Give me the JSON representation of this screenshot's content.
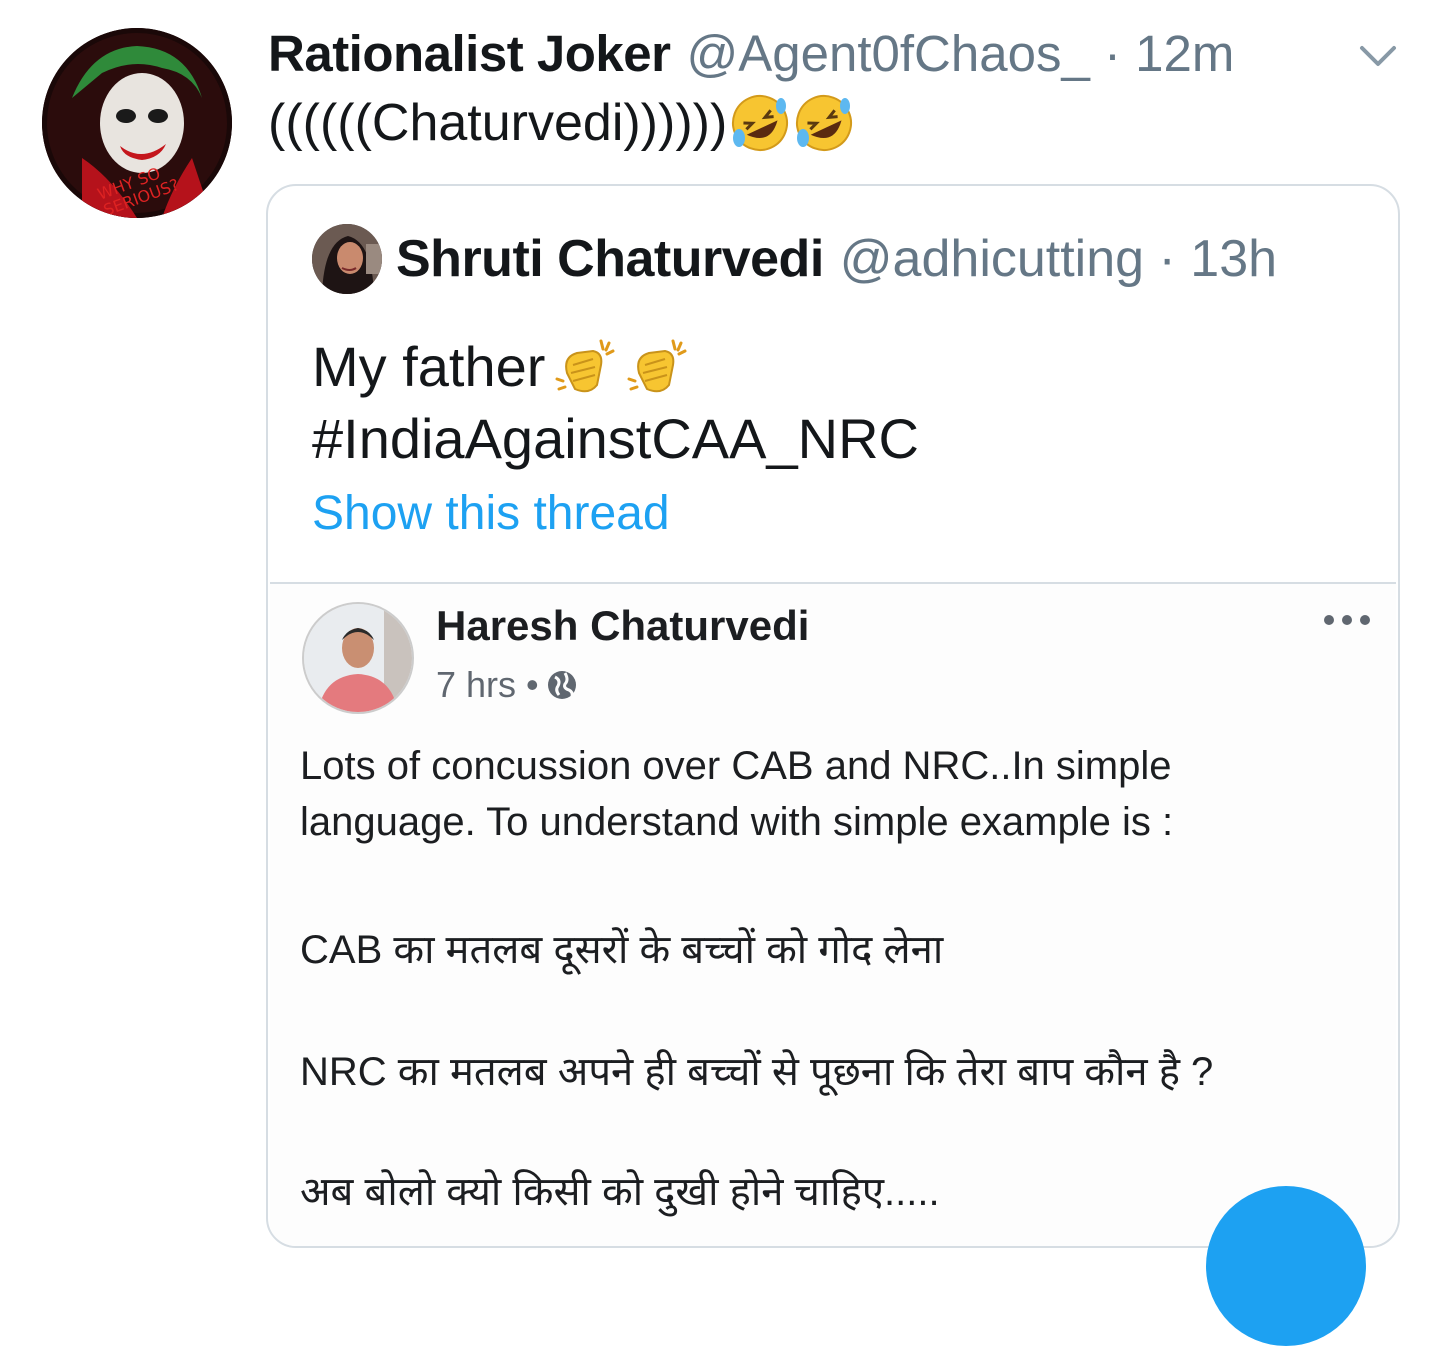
{
  "tweet": {
    "author_name": "Rationalist Joker",
    "author_handle_time": "@Agent0fChaos_ · 12m",
    "text": "((((((Chaturvedi))))))",
    "emojis": [
      "rolling-on-floor-laughing",
      "rolling-on-floor-laughing"
    ]
  },
  "quoted": {
    "author_name": "Shruti Chaturvedi",
    "author_handle_time": "@adhicutting · 13h",
    "text_line1": "My father",
    "emojis": [
      "clapping-hands",
      "clapping-hands"
    ],
    "hashtag": "#IndiaAgainstCAA_NRC",
    "show_thread": "Show this thread"
  },
  "fb_post": {
    "author_name": "Haresh Chaturvedi",
    "time": "7 hrs •",
    "lines": [
      "Lots of concussion over CAB and NRC..In simple",
      "language. To understand with simple example is :",
      "CAB का मतलब दूसरों के बच्चों को गोद लेना",
      "NRC का मतलब अपने ही बच्चों से पूछना कि तेरा बाप कौन है ?",
      "अब बोलो क्यो किसी को दुखी होने चाहिए....."
    ]
  },
  "colors": {
    "link_blue": "#1da1f2",
    "handle_gray": "#657786",
    "border": "#d6dde3"
  }
}
